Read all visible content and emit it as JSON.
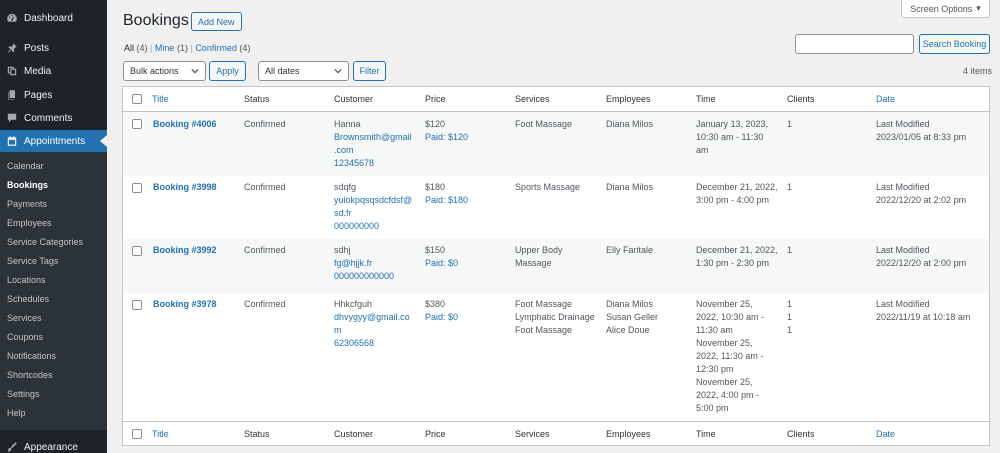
{
  "sidebar": {
    "menu": [
      {
        "label": "Dashboard",
        "icon": "dashboard-icon"
      },
      {
        "label": "Posts",
        "icon": "pin-icon"
      },
      {
        "label": "Media",
        "icon": "media-icon"
      },
      {
        "label": "Pages",
        "icon": "page-icon"
      },
      {
        "label": "Comments",
        "icon": "comment-icon"
      },
      {
        "label": "Appointments",
        "icon": "calendar-icon"
      }
    ],
    "submenu": [
      "Calendar",
      "Bookings",
      "Payments",
      "Employees",
      "Service Categories",
      "Service Tags",
      "Locations",
      "Schedules",
      "Services",
      "Coupons",
      "Notifications",
      "Shortcodes",
      "Settings",
      "Help"
    ],
    "bottom": {
      "label": "Appearance",
      "icon": "brush-icon"
    }
  },
  "header": {
    "title": "Bookings",
    "add_new": "Add New",
    "screen_options": "Screen Options"
  },
  "views": {
    "all": "All",
    "all_count": "(4)",
    "mine": "Mine",
    "mine_count": "(1)",
    "confirmed": "Confirmed",
    "confirmed_count": "(4)",
    "sep": "|"
  },
  "search": {
    "button": "Search Booking",
    "value": ""
  },
  "filters": {
    "bulk_actions": "Bulk actions",
    "apply": "Apply",
    "dates": "All dates",
    "filter": "Filter",
    "items_count": "4 items"
  },
  "columns": {
    "title": "Title",
    "status": "Status",
    "customer": "Customer",
    "price": "Price",
    "services": "Services",
    "employees": "Employees",
    "time": "Time",
    "clients": "Clients",
    "date": "Date"
  },
  "rows": [
    {
      "title": "Booking #4006",
      "status": "Confirmed",
      "customer_name": "Hanna",
      "customer_email": [
        "Brownsmith@gmail",
        ".com"
      ],
      "customer_phone": "12345678",
      "price": "$120",
      "paid": "Paid: $120",
      "services": [
        "Foot Massage"
      ],
      "employees": [
        "Diana Milos"
      ],
      "time": [
        "January 13, 2023,",
        "10:30 am - 11:30",
        "am"
      ],
      "clients": [
        "1"
      ],
      "date": [
        "Last Modified",
        "2023/01/05 at 8:33 pm"
      ]
    },
    {
      "title": "Booking #3998",
      "status": "Confirmed",
      "customer_name": "sdqfg",
      "customer_email": [
        "yuiokpqsqsdcfdsf@",
        "sd.fr"
      ],
      "customer_phone": "000000000",
      "price": "$180",
      "paid": "Paid: $180",
      "services": [
        "Sports Massage"
      ],
      "employees": [
        "Diana Milos"
      ],
      "time": [
        "December 21, 2022,",
        "3:00 pm - 4:00 pm"
      ],
      "clients": [
        "1"
      ],
      "date": [
        "Last Modified",
        "2022/12/20 at 2:02 pm"
      ]
    },
    {
      "title": "Booking #3992",
      "status": "Confirmed",
      "customer_name": "sdhj",
      "customer_email": [
        "fg@hjjk.fr"
      ],
      "customer_phone": "000000000000",
      "price": "$150",
      "paid": "Paid: $0",
      "services": [
        "Upper Body",
        "Massage"
      ],
      "employees": [
        "Elly Faritale"
      ],
      "time": [
        "December 21, 2022,",
        "1:30 pm - 2:30 pm"
      ],
      "clients": [
        "1"
      ],
      "date": [
        "Last Modified",
        "2022/12/20 at 2:00 pm"
      ]
    },
    {
      "title": "Booking #3978",
      "status": "Confirmed",
      "customer_name": "Hhkcfguh",
      "customer_email": [
        "dhvygyy@gmail.co",
        "m"
      ],
      "customer_phone": "62306568",
      "price": "$380",
      "paid": "Paid: $0",
      "services": [
        "Foot Massage",
        "Lymphatic Drainage",
        "Foot Massage"
      ],
      "employees": [
        "Diana Milos",
        "Susan Geller",
        "Alice Doue"
      ],
      "time": [
        "November 25,",
        "2022, 10:30 am -",
        "11:30 am",
        "November 25,",
        "2022, 11:30 am -",
        "12:30 pm",
        "November 25,",
        "2022, 4:00 pm -",
        "5:00 pm"
      ],
      "clients": [
        "1",
        "1",
        "1"
      ],
      "date": [
        "Last Modified",
        "2022/11/19 at 10:18 am"
      ]
    }
  ],
  "colors": {
    "sidebar": "#1d2327",
    "submenu": "#2c3338",
    "accent": "#2271b1",
    "background": "#f0f0f1"
  }
}
